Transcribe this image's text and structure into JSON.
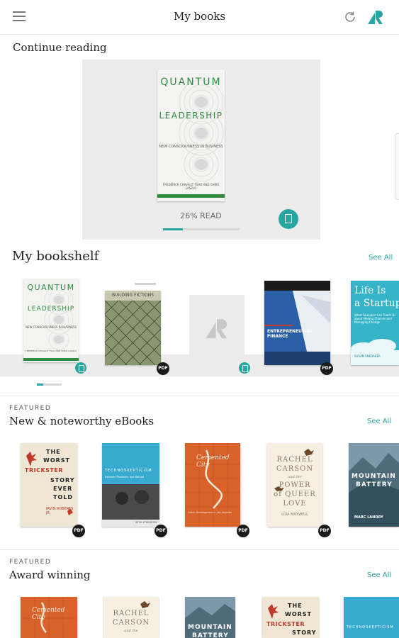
{
  "header": {
    "title": "My books",
    "menu_icon": "hamburger-menu-icon",
    "sync_icon": "sync-icon",
    "logo_icon": "app-logo-icon"
  },
  "continue_reading": {
    "heading": "Continue reading",
    "book": {
      "title_line1": "QUANTUM",
      "title_line2": "LEADERSHIP",
      "subtitle": "NEW CONSCIOUSNESS IN BUSINESS",
      "authors": "FREDERICK CHAVALIT TSAO AND CHRIS LASZLO",
      "progress_label": "26% READ",
      "progress": 0.26,
      "format_icon": "ebook-icon"
    }
  },
  "bookshelf": {
    "heading": "My bookshelf",
    "see_all": "See All",
    "items": [
      {
        "title_line1": "QUANTUM",
        "title_line2": "LEADERSHIP",
        "subtitle": "NEW CONSCIOUSNESS IN BUSINESS",
        "authors": "FREDERICK CHAVALIT TSAO AND CHRIS LASZLO",
        "badge": "ebook-icon"
      },
      {
        "title": "BUILDING FICTIONS",
        "badge": "PDF"
      },
      {
        "title": "",
        "badge": "audiobook-icon"
      },
      {
        "title": "ENTREPRENEURIAL FINANCE",
        "badge": "PDF"
      },
      {
        "title_line1": "Life Is",
        "title_line2": "a Startup",
        "subtitle": "What Founders Can Teach Us about Making Choices and Managing Change",
        "authors": "SUSAN SNEDAKER"
      }
    ],
    "page_indicator": 0.25
  },
  "new_noteworthy": {
    "featured_label": "FEATURED",
    "heading": "New & noteworthy eBooks",
    "see_all": "See All",
    "items": [
      {
        "title_line1": "THE",
        "title_line2": "WORST",
        "title_line3": "TRICKSTER",
        "title_line4": "STORY",
        "title_line5": "EVER",
        "title_line6": "TOLD",
        "author": "IRVIN ROBERTS JR.",
        "badge": "PDF"
      },
      {
        "title": "TECHNOSKEPTICISM",
        "subtitle": "Between Possibility and Refusal",
        "author": "SETH STURGEON",
        "badge": "PDF"
      },
      {
        "title": "Cemented City",
        "subtitle": "Urban Development in Los Angeles",
        "badge": "PDF"
      },
      {
        "title_line1": "RACHEL",
        "title_line2": "CARSON",
        "title_line3": "and the",
        "title_line4": "POWER",
        "title_line5": "of QUEER",
        "title_line6": "LOVE",
        "author": "LIDA MAXWELL",
        "badge": "PDF"
      },
      {
        "title_line1": "MOUNTAIN",
        "title_line2": "BATTERY",
        "author": "MARC LANDRY"
      }
    ]
  },
  "award_winning": {
    "featured_label": "FEATURED",
    "heading": "Award winning",
    "see_all": "See All",
    "items": [
      {
        "title": "Cemented City"
      },
      {
        "title_line1": "RACHEL",
        "title_line2": "CARSON",
        "title_line3": "and the"
      },
      {
        "title_line1": "MOUNTAIN",
        "title_line2": "BATTERY"
      },
      {
        "title_line1": "THE",
        "title_line2": "WORST",
        "title_line3": "TRICKSTER",
        "title_line4": "STORY"
      },
      {
        "title": "TECHNOSKEPTICISM"
      }
    ]
  },
  "colors": {
    "accent": "#27a6a1",
    "divider": "#e6e6e6",
    "continue_bg": "#ececec"
  }
}
